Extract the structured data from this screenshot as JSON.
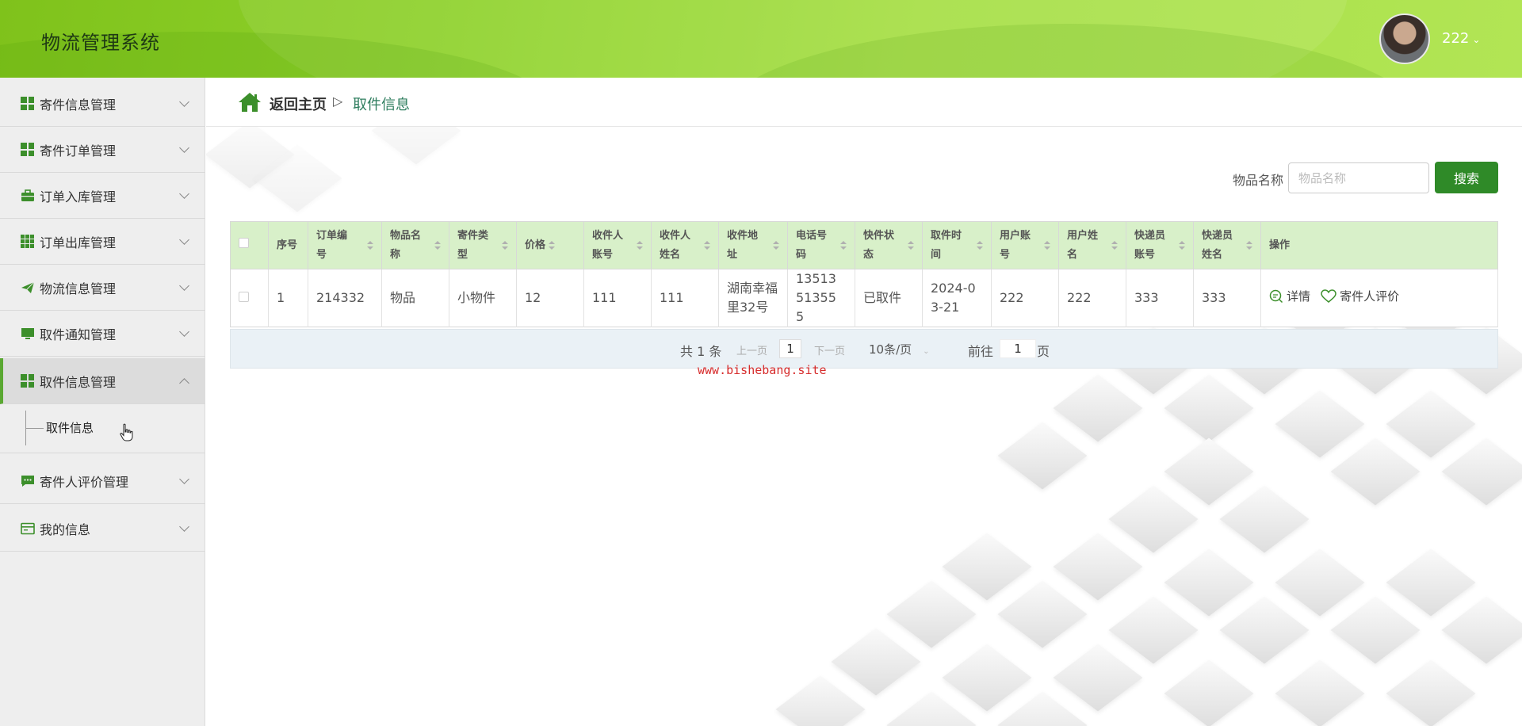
{
  "app": {
    "title": "物流管理系统",
    "user_name": "222"
  },
  "sidebar": {
    "items": [
      {
        "label": "寄件信息管理"
      },
      {
        "label": "寄件订单管理"
      },
      {
        "label": "订单入库管理"
      },
      {
        "label": "订单出库管理"
      },
      {
        "label": "物流信息管理"
      },
      {
        "label": "取件通知管理"
      },
      {
        "label": "取件信息管理"
      },
      {
        "label": "寄件人评价管理"
      },
      {
        "label": "我的信息"
      }
    ],
    "submenu_label": "取件信息"
  },
  "breadcrumb": {
    "home": "返回主页",
    "separator": "▷",
    "current": "取件信息"
  },
  "search": {
    "label": "物品名称",
    "placeholder": "物品名称",
    "button": "搜索"
  },
  "table": {
    "headers": [
      "序号",
      "订单编号",
      "物品名称",
      "寄件类型",
      "价格",
      "收件人账号",
      "收件人姓名",
      "收件地址",
      "电话号码",
      "快件状态",
      "取件时间",
      "用户账号",
      "用户姓名",
      "快递员账号",
      "快递员姓名",
      "操作"
    ],
    "rows": [
      {
        "cells": [
          "1",
          "214332",
          "物品",
          "小物件",
          "12",
          "111",
          "111",
          "湖南幸福里32号",
          "13513513555",
          "已取件",
          "2024-03-21",
          "222",
          "222",
          "333",
          "333"
        ],
        "actions": {
          "detail": "详情",
          "review": "寄件人评价"
        }
      }
    ]
  },
  "pager": {
    "total": "共 1 条",
    "prev": "上一页",
    "page": "1",
    "next": "下一页",
    "page_size": "10条/页",
    "goto": "前往",
    "goto_value": "1",
    "page_suffix": "页"
  },
  "watermark": "www.bishebang.site",
  "colors": {
    "accent": "#2f8a28",
    "header_green": "#8fd22c",
    "table_header": "#d8f0c9",
    "watermark": "#d62b2b"
  }
}
